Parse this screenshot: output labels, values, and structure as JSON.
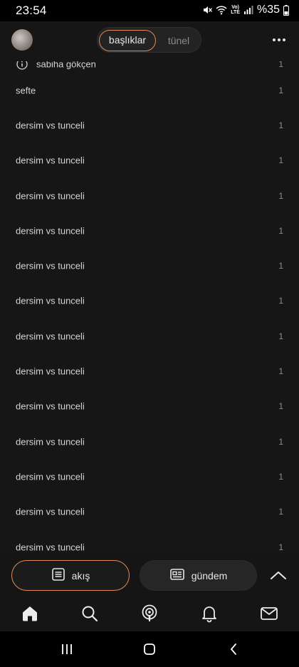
{
  "status_bar": {
    "time": "23:54",
    "battery": "%35"
  },
  "header": {
    "tabs": [
      {
        "label": "başlıklar",
        "active": true
      },
      {
        "label": "tünel",
        "active": false
      }
    ],
    "avatar_icon": "avatar",
    "more_icon": "more-dots-icon"
  },
  "topics": [
    {
      "title": "sabiha gökçen",
      "count": "1",
      "icon": "info-icon"
    },
    {
      "title": "sefte",
      "count": "1"
    },
    {
      "title": "dersim vs tunceli",
      "count": "1"
    },
    {
      "title": "dersim vs tunceli",
      "count": "1"
    },
    {
      "title": "dersim vs tunceli",
      "count": "1"
    },
    {
      "title": "dersim vs tunceli",
      "count": "1"
    },
    {
      "title": "dersim vs tunceli",
      "count": "1"
    },
    {
      "title": "dersim vs tunceli",
      "count": "1"
    },
    {
      "title": "dersim vs tunceli",
      "count": "1"
    },
    {
      "title": "dersim vs tunceli",
      "count": "1"
    },
    {
      "title": "dersim vs tunceli",
      "count": "1"
    },
    {
      "title": "dersim vs tunceli",
      "count": "1"
    },
    {
      "title": "dersim vs tunceli",
      "count": "1"
    },
    {
      "title": "dersim vs tunceli",
      "count": "1"
    },
    {
      "title": "dersim vs tunceli",
      "count": "1"
    }
  ],
  "bottom_bar": {
    "akis_label": "akış",
    "gundem_label": "gündem",
    "nav_icons": [
      "home-icon",
      "search-icon",
      "podcast-icon",
      "bell-icon",
      "mail-icon"
    ]
  },
  "colors": {
    "accent": "#e08a5c",
    "background": "#161616",
    "text": "#d4d4d4"
  }
}
